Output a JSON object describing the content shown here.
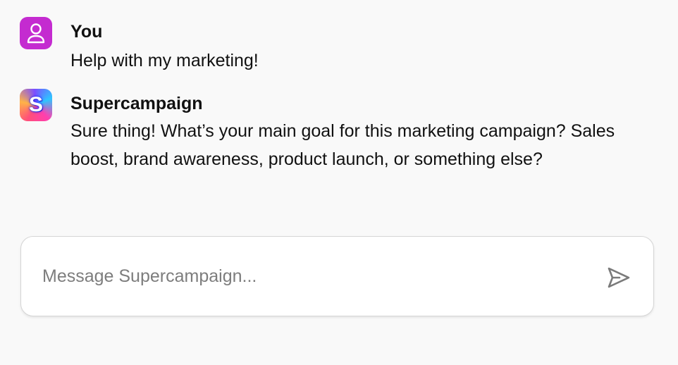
{
  "conversation": {
    "messages": [
      {
        "author": "You",
        "text": "Help with my marketing!",
        "avatar_icon": "user-icon",
        "avatar_color": "#c42bd0"
      },
      {
        "author": "Supercampaign",
        "text": "Sure thing! What’s your main goal for this marketing campaign? Sales boost, brand awareness, product launch, or something else?",
        "avatar_icon": "supercampaign-logo-icon",
        "avatar_letter": "S"
      }
    ]
  },
  "composer": {
    "placeholder": "Message Supercampaign...",
    "value": "",
    "send_icon": "send-icon"
  }
}
